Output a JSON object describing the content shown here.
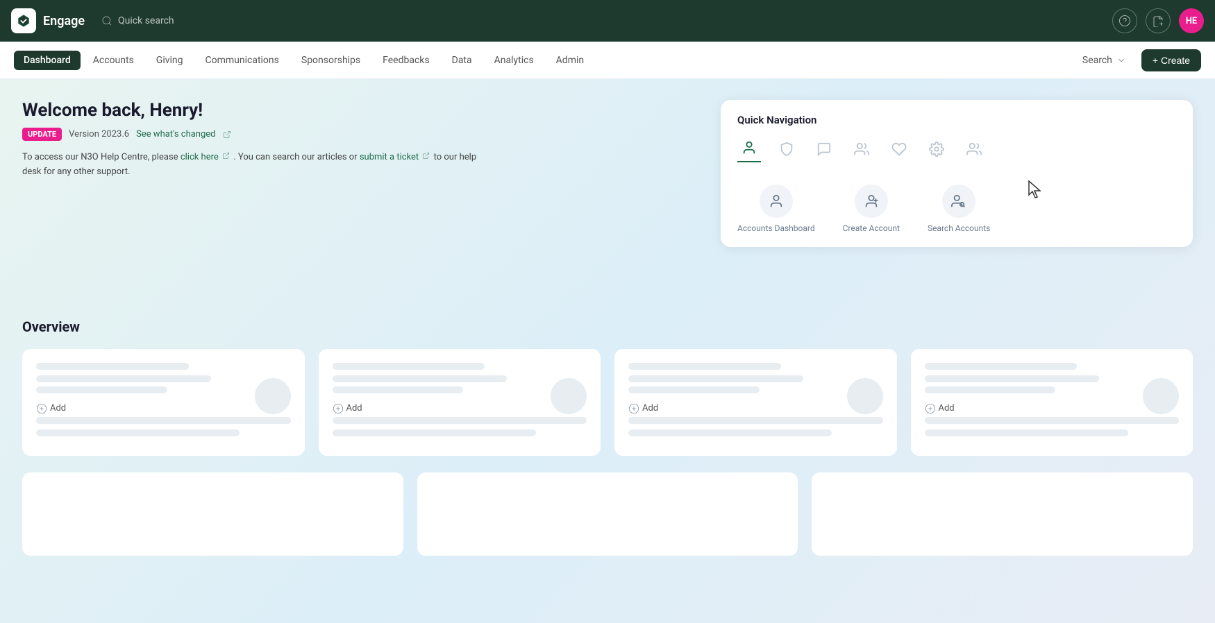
{
  "app": {
    "name": "Engage",
    "logo_alt": "Engage logo"
  },
  "topnav": {
    "quick_search_placeholder": "Quick search",
    "help_label": "help",
    "notifications_label": "notifications",
    "avatar_initials": "HE"
  },
  "secnav": {
    "items": [
      {
        "label": "Dashboard",
        "active": true
      },
      {
        "label": "Accounts",
        "active": false
      },
      {
        "label": "Giving",
        "active": false
      },
      {
        "label": "Communications",
        "active": false
      },
      {
        "label": "Sponsorships",
        "active": false
      },
      {
        "label": "Feedbacks",
        "active": false
      },
      {
        "label": "Data",
        "active": false
      },
      {
        "label": "Analytics",
        "active": false
      },
      {
        "label": "Admin",
        "active": false
      }
    ],
    "search_label": "Search",
    "create_label": "+ Create"
  },
  "welcome": {
    "title": "Welcome back, Henry!",
    "badge": "UPDATE",
    "version": "Version 2023.6",
    "see_changed": "See what's changed",
    "help_text_1": "To access our N3O Help Centre, please",
    "click_here": "click here",
    "help_text_2": ". You can search our articles or",
    "submit_ticket": "submit a ticket",
    "help_text_3": "to our help desk for any other support."
  },
  "quick_nav": {
    "title": "Quick Navigation",
    "icons": [
      {
        "name": "accounts-icon",
        "active": true
      },
      {
        "name": "giving-icon",
        "active": false
      },
      {
        "name": "communications-icon",
        "active": false
      },
      {
        "name": "people-icon",
        "active": false
      },
      {
        "name": "heart-icon",
        "active": false
      },
      {
        "name": "settings-icon",
        "active": false
      },
      {
        "name": "team-icon",
        "active": false
      }
    ],
    "shortcuts": [
      {
        "label": "Accounts Dashboard",
        "name": "accounts-dashboard-shortcut"
      },
      {
        "label": "Create Account",
        "name": "create-account-shortcut"
      },
      {
        "label": "Search Accounts",
        "name": "search-accounts-shortcut"
      }
    ]
  },
  "overview": {
    "title": "Overview",
    "cards": [
      {
        "id": "card-1"
      },
      {
        "id": "card-2"
      },
      {
        "id": "card-3"
      },
      {
        "id": "card-4"
      }
    ],
    "add_label": "Add",
    "bottom_cards": [
      {
        "id": "bottom-card-1"
      },
      {
        "id": "bottom-card-2"
      },
      {
        "id": "bottom-card-3"
      }
    ]
  }
}
